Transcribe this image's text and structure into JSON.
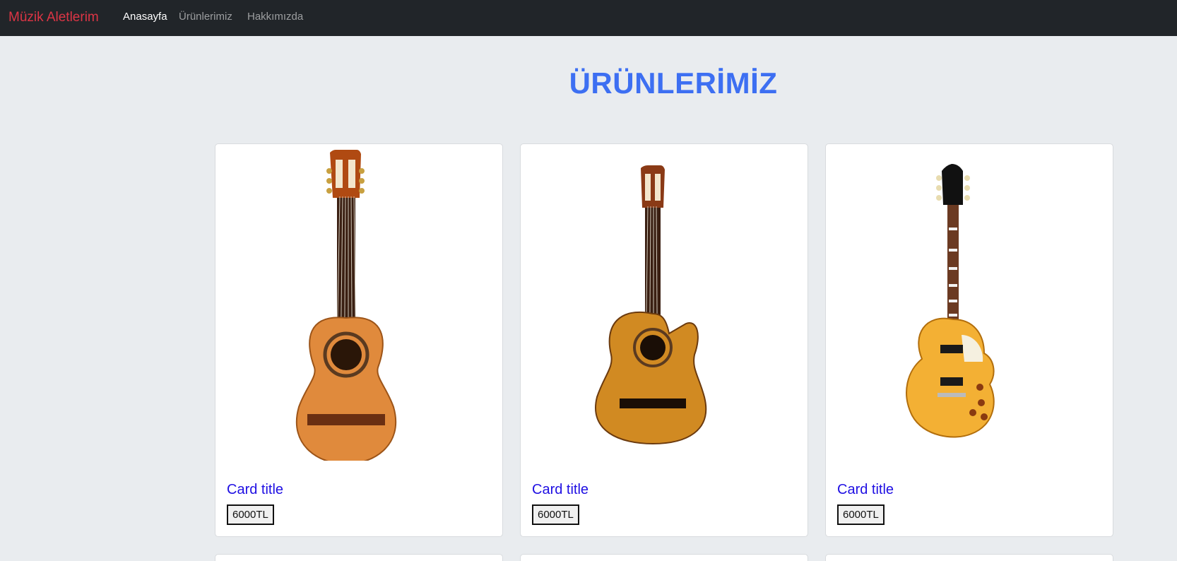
{
  "navbar": {
    "brand": "Müzik Aletlerim",
    "links": [
      {
        "label": "Anasayfa",
        "active": true
      },
      {
        "label": "Ürünlerimiz",
        "active": false
      },
      {
        "label": "Hakkımızda",
        "active": false
      }
    ]
  },
  "page": {
    "title": "ÜRÜNLERİMİZ"
  },
  "products": [
    {
      "image": "classical-guitar-image",
      "title": "Card title",
      "price": "6000TL"
    },
    {
      "image": "cutaway-acoustic-guitar-image",
      "title": "Card title",
      "price": "6000TL"
    },
    {
      "image": "electric-guitar-image",
      "title": "Card title",
      "price": "6000TL"
    }
  ],
  "colors": {
    "navbar_bg": "#212529",
    "brand": "#dc3545",
    "title": "#3d6ff2",
    "card_title": "#1f0fe3",
    "page_bg": "#e9ecef"
  }
}
